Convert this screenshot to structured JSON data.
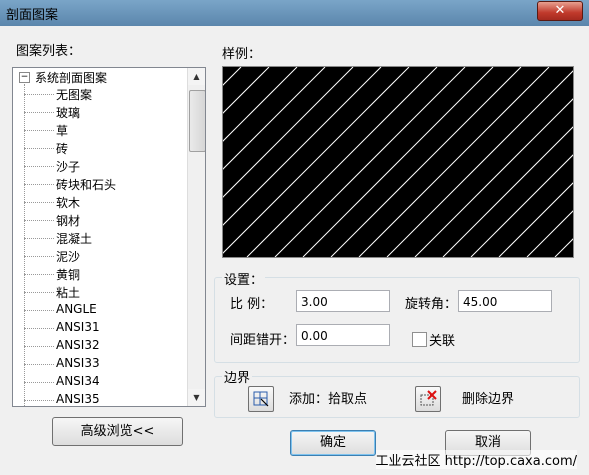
{
  "window": {
    "title": "剖面图案",
    "close_glyph": "✕"
  },
  "pattern_list": {
    "label": "图案列表：",
    "root_label": "系统剖面图案",
    "root_toggle": "−",
    "items": [
      "无图案",
      "玻璃",
      "草",
      "砖",
      "沙子",
      "砖块和石头",
      "软木",
      "钢材",
      "混凝土",
      "泥沙",
      "黄铜",
      "粘土",
      "ANGLE",
      "ANSI31",
      "ANSI32",
      "ANSI33",
      "ANSI34",
      "ANSI35"
    ]
  },
  "preview": {
    "label": "样例：",
    "pattern": "diagonal-hatch",
    "background_color": "#000000",
    "line_color": "#ffffff"
  },
  "settings": {
    "label": "设置：",
    "scale_label": "比    例：",
    "scale_value": "3.00",
    "rotation_label": "旋转角：",
    "rotation_value": "45.00",
    "spacing_label": "间距错开：",
    "spacing_value": "0.00",
    "associate_label": "关联",
    "associate_checked": false
  },
  "boundary": {
    "label": "边界",
    "add_label": "添加：拾取点",
    "delete_label": "删除边界",
    "pick_icon": "pick-point-icon",
    "delete_icon": "delete-boundary-icon"
  },
  "buttons": {
    "advanced": "高级浏览<<",
    "ok": "确定",
    "cancel": "取消"
  },
  "watermark": "工业云社区 http://top.caxa.com/"
}
